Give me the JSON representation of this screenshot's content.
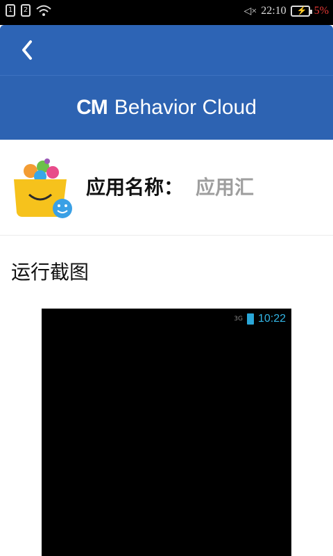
{
  "status_bar": {
    "sim1": "1",
    "sim2": "2",
    "time": "22:10",
    "battery_percent": "5%"
  },
  "header": {
    "brand_prefix": "CM",
    "brand_name": "Behavior Cloud"
  },
  "app_info": {
    "label": "应用名称：",
    "value": "应用汇"
  },
  "section": {
    "title": "运行截图"
  },
  "preview": {
    "network": "3G",
    "time": "10:22"
  },
  "colors": {
    "header_blue": "#2d64b5",
    "battery_low": "#e53935",
    "preview_time": "#33b5e5"
  }
}
